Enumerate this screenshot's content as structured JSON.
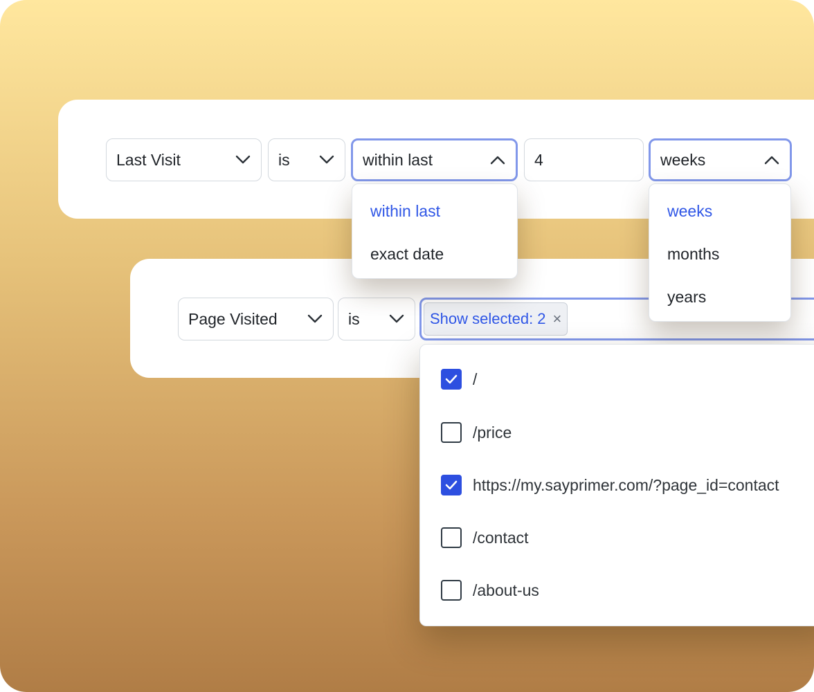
{
  "filter_row_1": {
    "attribute": "Last Visit",
    "operator": "is",
    "condition": "within last",
    "amount": "4",
    "unit": "weeks"
  },
  "condition_menu": {
    "options": [
      {
        "label": "within last",
        "selected": true
      },
      {
        "label": "exact date",
        "selected": false
      }
    ]
  },
  "unit_menu": {
    "options": [
      {
        "label": "weeks",
        "selected": true
      },
      {
        "label": "months",
        "selected": false
      },
      {
        "label": "years",
        "selected": false
      }
    ]
  },
  "filter_row_2": {
    "attribute": "Page Visited",
    "operator": "is",
    "chip_label": "Show selected: 2",
    "chip_remove": "×"
  },
  "pages_list": {
    "options": [
      {
        "label": "/",
        "checked": true
      },
      {
        "label": "/price",
        "checked": false
      },
      {
        "label": "https://my.sayprimer.com/?page_id=contact",
        "checked": true
      },
      {
        "label": "/contact",
        "checked": false
      },
      {
        "label": "/about-us",
        "checked": false
      }
    ]
  },
  "colors": {
    "accent": "#2f56e6",
    "focus_border": "#8197ea",
    "checkbox_checked": "#2d4fe0"
  },
  "icons": {
    "dropdown_closed": "chevron-down-icon",
    "dropdown_open": "chevron-up-icon",
    "check": "check-icon",
    "remove": "close-icon"
  }
}
